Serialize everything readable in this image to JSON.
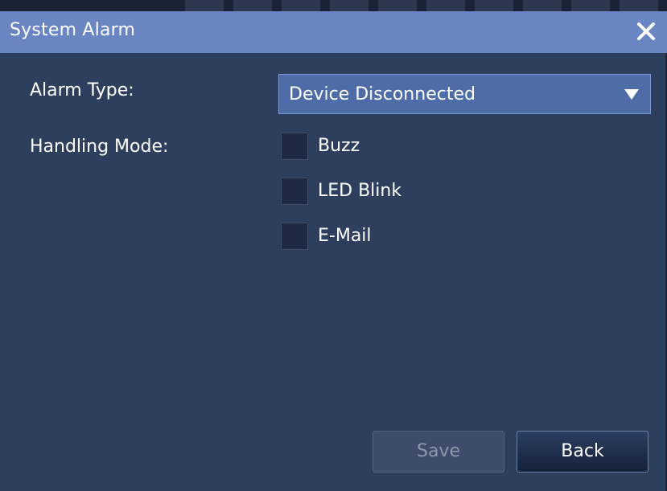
{
  "dialog": {
    "title": "System Alarm",
    "close_icon": "close-icon"
  },
  "form": {
    "alarm_type_label": "Alarm Type:",
    "alarm_type_value": "Device Disconnected",
    "handling_mode_label": "Handling Mode:",
    "handling_options": [
      {
        "label": "Buzz",
        "checked": false
      },
      {
        "label": "LED Blink",
        "checked": false
      },
      {
        "label": "E-Mail",
        "checked": false
      }
    ]
  },
  "buttons": {
    "save_label": "Save",
    "save_enabled": false,
    "back_label": "Back"
  },
  "colors": {
    "titlebar": "#6a86c2",
    "body": "#2e3e5d",
    "select": "#4d6ca8"
  }
}
